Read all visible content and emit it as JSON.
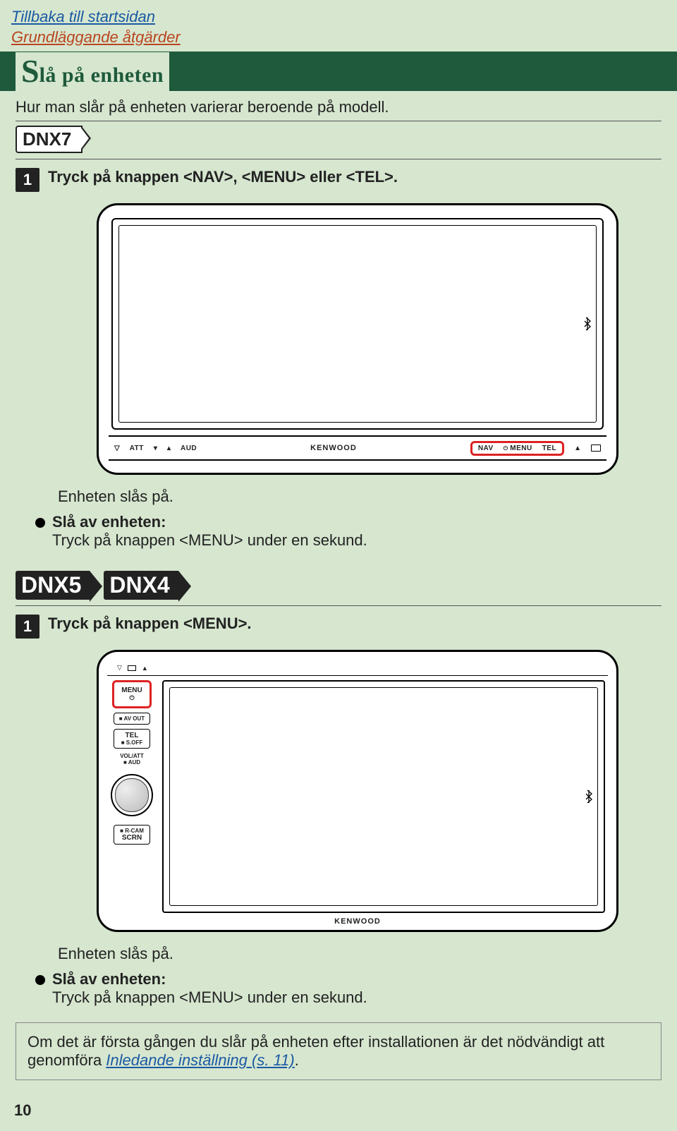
{
  "nav": {
    "back": "Tillbaka till startsidan",
    "basics": "Grundläggande åtgärder"
  },
  "heading": {
    "drop": "S",
    "rest": "lå på enheten"
  },
  "intro": "Hur man slår på enheten varierar beroende på modell.",
  "model7": "DNX7",
  "step7": "Tryck på knappen <NAV>, <MENU> eller <TEL>.",
  "stepNum": "1",
  "dev7": {
    "att": "ATT",
    "aud": "AUD",
    "kenwood": "KENWOOD",
    "nav": "NAV",
    "menu": "MENU",
    "tel": "TEL"
  },
  "turnedOn": "Enheten slås på.",
  "turnOffHead": "Slå av enheten:",
  "turnOffBody": "Tryck på knappen <MENU> under en sekund.",
  "model5": "DNX5",
  "model4": "DNX4",
  "step5": "Tryck på knappen <MENU>.",
  "dev5": {
    "menu": "MENU",
    "avout": "■ AV OUT",
    "tel": "TEL",
    "soff": "■ S.OFF",
    "vol": "VOL/ATT\n■ AUD",
    "rcam": "■ R-CAM",
    "scrn": "SCRN",
    "power": "⏻",
    "kenwood": "KENWOOD"
  },
  "note": {
    "a": "Om det är första gången du slår på enheten efter installationen är det nödvändigt att genomföra ",
    "b": "Inledande inställning (s. 11)",
    "c": "."
  },
  "page": "10"
}
